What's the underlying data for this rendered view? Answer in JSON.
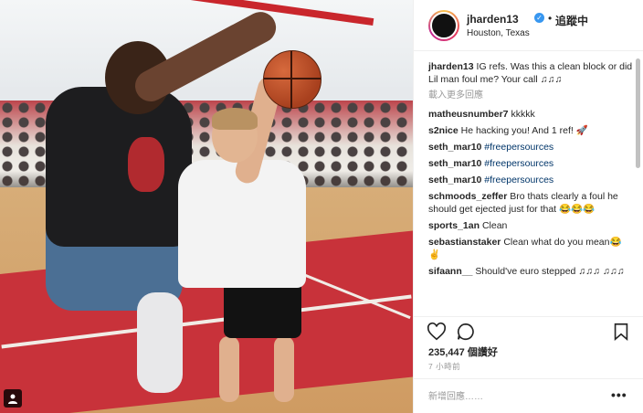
{
  "post": {
    "username": "jharden13",
    "follow_label": "追蹤中",
    "separator": "•",
    "location": "Houston, Texas",
    "verified_icon": "✓"
  },
  "caption": {
    "username": "jharden13",
    "text": "IG refs. Was this a clean block or did Lil man foul me? Your call ♫♫♫",
    "load_more": "載入更多回應"
  },
  "comments": [
    {
      "user": "matheusnumber7",
      "text": "kkkkk"
    },
    {
      "user": "s2nice",
      "text": "He hacking you! And 1 ref! 🚀"
    },
    {
      "user": "seth_mar10",
      "text": "#freepersources",
      "hashtag": true
    },
    {
      "user": "seth_mar10",
      "text": "#freepersources",
      "hashtag": true
    },
    {
      "user": "seth_mar10",
      "text": "#freepersources",
      "hashtag": true
    },
    {
      "user": "schmoods_zeffer",
      "text": "Bro thats clearly a foul he should get ejected just for that 😂😂😂"
    },
    {
      "user": "sports_1an",
      "text": "Clean"
    },
    {
      "user": "sebastianstaker",
      "text": "Clean what do you mean😂 ✌"
    },
    {
      "user": "sifaann__",
      "text": "Should've euro stepped ♫♫♫ ♫♫♫"
    }
  ],
  "stats": {
    "likes": "235,447 個讚好",
    "time": "7 小時前"
  },
  "comment_box": {
    "placeholder": "新增回應……",
    "more": "•••"
  },
  "colors": {
    "accent_blue": "#3897f0",
    "hashtag": "#003569",
    "muted": "#999999"
  }
}
